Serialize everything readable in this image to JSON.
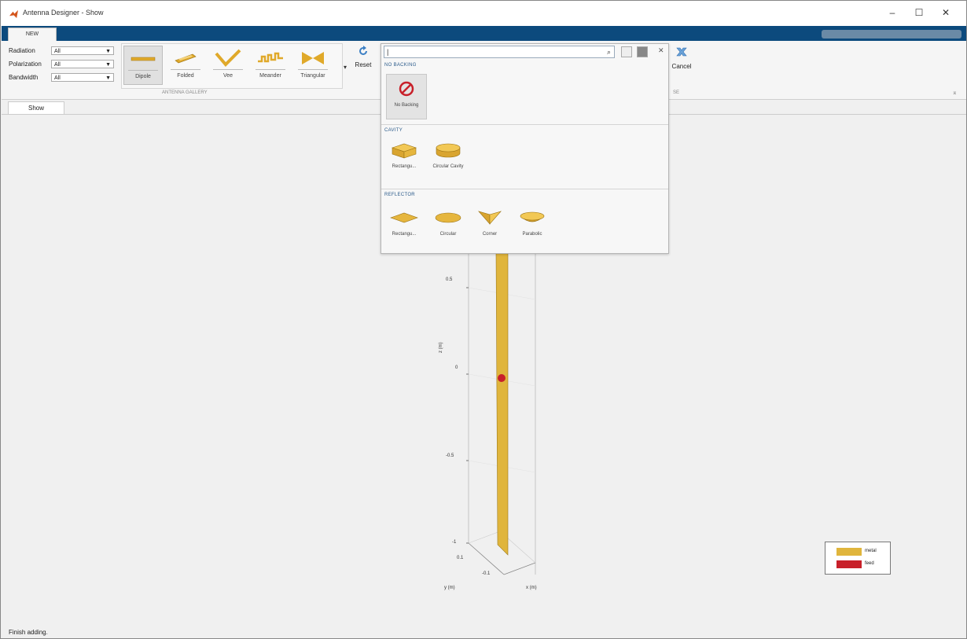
{
  "window": {
    "title": "Antenna Designer - Show",
    "minimize": "–",
    "maximize": "☐",
    "close": "✕"
  },
  "ribbon": {
    "tab": "NEW",
    "filters": [
      {
        "label": "Radiation",
        "value": "All"
      },
      {
        "label": "Polarization",
        "value": "All"
      },
      {
        "label": "Bandwidth",
        "value": "All"
      }
    ],
    "gallery": {
      "items": [
        {
          "label": "Dipole",
          "icon": "dipole-icon"
        },
        {
          "label": "Folded",
          "icon": "folded-dipole-icon"
        },
        {
          "label": "Vee",
          "icon": "vee-icon"
        },
        {
          "label": "Meander",
          "icon": "meander-icon"
        },
        {
          "label": "Triangular",
          "icon": "bowtie-icon"
        }
      ],
      "caption": "ANTENNA GALLERY"
    },
    "reset_label": "Reset",
    "cancel_label": "Cancel",
    "section2_caption": "SE"
  },
  "doc_tab": "Show",
  "popup": {
    "search_value": "",
    "sections": [
      {
        "title": "NO BACKING",
        "items": [
          {
            "label": "No Backing",
            "icon": "no-backing-icon"
          }
        ]
      },
      {
        "title": "CAVITY",
        "items": [
          {
            "label": "Rectangu...",
            "icon": "rect-cavity-icon"
          },
          {
            "label": "Circular Cavity",
            "icon": "circ-cavity-icon"
          }
        ]
      },
      {
        "title": "REFLECTOR",
        "items": [
          {
            "label": "Rectangu...",
            "icon": "rect-reflector-icon"
          },
          {
            "label": "Circular",
            "icon": "circ-reflector-icon"
          },
          {
            "label": "Corner",
            "icon": "corner-reflector-icon"
          },
          {
            "label": "Parabolic",
            "icon": "parabolic-reflector-icon"
          }
        ]
      }
    ]
  },
  "plot": {
    "z_label": "z (m)",
    "y_label": "y (m)",
    "x_label": "x (m)",
    "z_ticks": [
      "0.5",
      "0",
      "-0.5",
      "-1"
    ],
    "y_tick": "0.1",
    "x_tick": "-0.1",
    "legend": [
      {
        "label": "metal",
        "color": "#e0b53c"
      },
      {
        "label": "feed",
        "color": "#c8202a"
      }
    ]
  },
  "status": "Finish adding."
}
